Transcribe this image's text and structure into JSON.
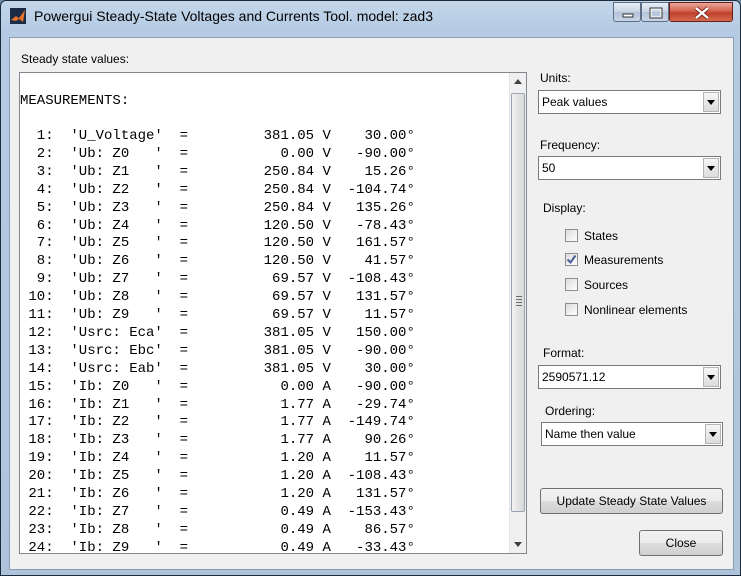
{
  "window": {
    "title": "Powergui Steady-State Voltages and Currents Tool.  model: zad3",
    "icons": {
      "app": "matlab-logo-icon",
      "minimize": "minimize-icon",
      "maximize": "maximize-icon",
      "close": "close-icon"
    }
  },
  "main": {
    "steady_label": "Steady state values:",
    "list": {
      "header": "MEASUREMENTS:",
      "lines": [
        "  1:  'U_Voltage'  =         381.05 V    30.00°",
        "  2:  'Ub: Z0   '  =           0.00 V   -90.00°",
        "  3:  'Ub: Z1   '  =         250.84 V    15.26°",
        "  4:  'Ub: Z2   '  =         250.84 V  -104.74°",
        "  5:  'Ub: Z3   '  =         250.84 V   135.26°",
        "  6:  'Ub: Z4   '  =         120.50 V   -78.43°",
        "  7:  'Ub: Z5   '  =         120.50 V   161.57°",
        "  8:  'Ub: Z6   '  =         120.50 V    41.57°",
        "  9:  'Ub: Z7   '  =          69.57 V  -108.43°",
        " 10:  'Ub: Z8   '  =          69.57 V   131.57°",
        " 11:  'Ub: Z9   '  =          69.57 V    11.57°",
        " 12:  'Usrc: Eca'  =         381.05 V   150.00°",
        " 13:  'Usrc: Ebc'  =         381.05 V   -90.00°",
        " 14:  'Usrc: Eab'  =         381.05 V    30.00°",
        " 15:  'Ib: Z0   '  =           0.00 A   -90.00°",
        " 16:  'Ib: Z1   '  =           1.77 A   -29.74°",
        " 17:  'Ib: Z2   '  =           1.77 A  -149.74°",
        " 18:  'Ib: Z3   '  =           1.77 A    90.26°",
        " 19:  'Ib: Z4   '  =           1.20 A    11.57°",
        " 20:  'Ib: Z5   '  =           1.20 A  -108.43°",
        " 21:  'Ib: Z6   '  =           1.20 A   131.57°",
        " 22:  'Ib: Z7   '  =           0.49 A  -153.43°",
        " 23:  'Ib: Z8   '  =           0.49 A    86.57°",
        " 24:  'Ib: Z9   '  =           0.49 A   -33.43°"
      ]
    }
  },
  "side": {
    "units_label": "Units:",
    "units_value": "Peak values",
    "frequency_label": "Frequency:",
    "frequency_value": "50",
    "display_label": "Display:",
    "checks": [
      {
        "label": "States",
        "checked": false
      },
      {
        "label": "Measurements",
        "checked": true
      },
      {
        "label": "Sources",
        "checked": false
      },
      {
        "label": "Nonlinear elements",
        "checked": false
      }
    ],
    "format_label": "Format:",
    "format_value": "2590571.12",
    "ordering_label": "Ordering:",
    "ordering_value": "Name then value",
    "update_button": "Update Steady State Values",
    "close_button": "Close"
  }
}
